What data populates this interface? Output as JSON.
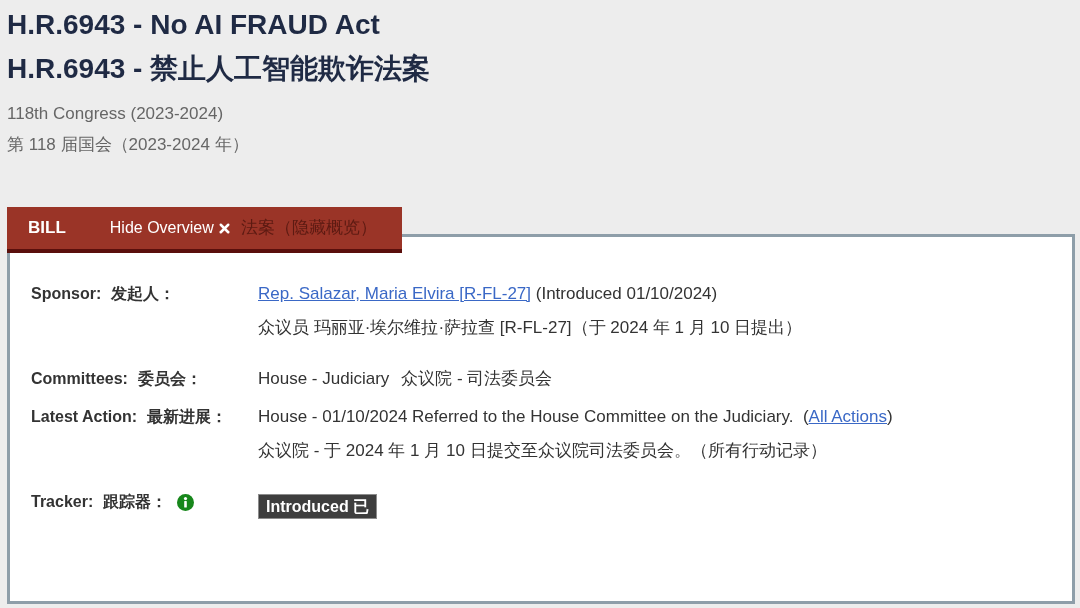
{
  "title_lines": [
    "H.R.6943 - No AI FRAUD Act",
    "H.R.6943 - 禁止人工智能欺诈法案"
  ],
  "congress_lines": [
    "118th Congress (2023-2024)",
    "第 118 届国会（2023-2024 年）"
  ],
  "overview": {
    "tab": {
      "label": "BILL",
      "toggle": "Hide Overview",
      "translation": "法案（隐藏概览）"
    },
    "fields": [
      {
        "kind": "stacked",
        "label": "Sponsor:",
        "label_zh": "发起人：",
        "value": [
          {
            "kind": "link",
            "text": "Rep. Salazar, Maria Elvira [R-FL-27]"
          },
          {
            "kind": "text",
            "text": " (Introduced 01/10/2024)"
          }
        ],
        "translation": "众议员 玛丽亚·埃尔维拉·萨拉查 [R-FL-27]（于 2024 年 1 月 10 日提出）"
      },
      {
        "kind": "inline",
        "label": "Committees:",
        "label_zh": "委员会：",
        "value": [
          {
            "kind": "text",
            "text": "House - Judiciary"
          }
        ],
        "translation": "众议院 - 司法委员会"
      },
      {
        "kind": "stacked",
        "label": "Latest Action:",
        "label_zh": "最新进展：",
        "value": [
          {
            "kind": "text",
            "text": "House - 01/10/2024 Referred to the House Committee on the Judiciary.  ("
          },
          {
            "kind": "link",
            "text": "All Actions"
          },
          {
            "kind": "text",
            "text": ")"
          }
        ],
        "translation": "众议院 - 于 2024 年 1 月 10 日提交至众议院司法委员会。（所有行动记录）"
      },
      {
        "kind": "tracker",
        "label": "Tracker:",
        "label_zh": "跟踪器：",
        "badge": "Introduced 已"
      }
    ]
  }
}
